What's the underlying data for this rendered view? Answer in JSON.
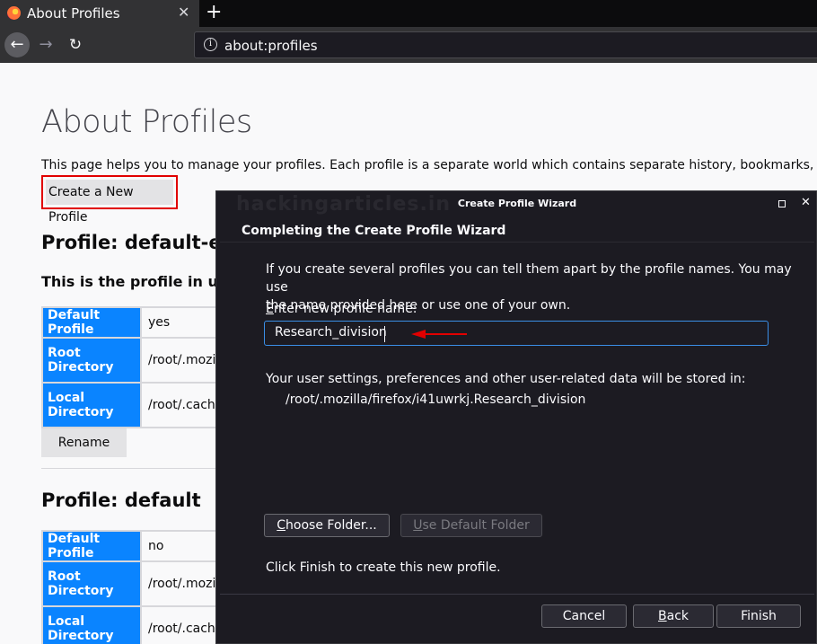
{
  "browser": {
    "tab_title": "About Profiles",
    "tab_close": "✕",
    "new_tab": "+",
    "url": "about:profiles"
  },
  "page": {
    "heading": "About Profiles",
    "intro": "This page helps you to manage your profiles. Each profile is a separate world which contains separate history, bookmarks, settings",
    "create_button": "Create a New Profile",
    "watermark": "hackingarticles.in",
    "profiles": [
      {
        "title": "Profile: default-esr",
        "subtitle": "This is the profile in use a",
        "rows": [
          {
            "key": "Default Profile",
            "value": "yes"
          },
          {
            "key": "Root Directory",
            "value": "/root/.mozill"
          },
          {
            "key": "Local Directory",
            "value": "/root/.cache"
          }
        ],
        "rename": "Rename"
      },
      {
        "title": "Profile: default",
        "rows": [
          {
            "key": "Default Profile",
            "value": "no"
          },
          {
            "key": "Root Directory",
            "value": "/root/.mozill"
          },
          {
            "key": "Local Directory",
            "value": "/root/.cache"
          }
        ]
      }
    ]
  },
  "wizard": {
    "window_title": "Create Profile Wizard",
    "heading": "Completing the Create Profile Wizard",
    "description": "If you create several profiles you can tell them apart by the profile names. You may use the name provided here or use one of your own.",
    "desc_line1": "If you create several profiles you can tell them apart by the profile names. You may use",
    "desc_line2": "the name provided here or use one of your own.",
    "name_label_first": "E",
    "name_label_rest": "nter new profile name:",
    "name_value": "Research_division",
    "storage_text": "Your user settings, preferences and other user-related data will be stored in:",
    "storage_path": "/root/.mozilla/firefox/i41uwrkj.Research_division",
    "choose_folder_first": "C",
    "choose_folder_rest": "hoose Folder...",
    "default_folder_first": "U",
    "default_folder_rest": "se Default Folder",
    "finish_text": "Click Finish to create this new profile.",
    "cancel": "Cancel",
    "back_first": "B",
    "back_rest": "ack",
    "finish": "Finish"
  }
}
